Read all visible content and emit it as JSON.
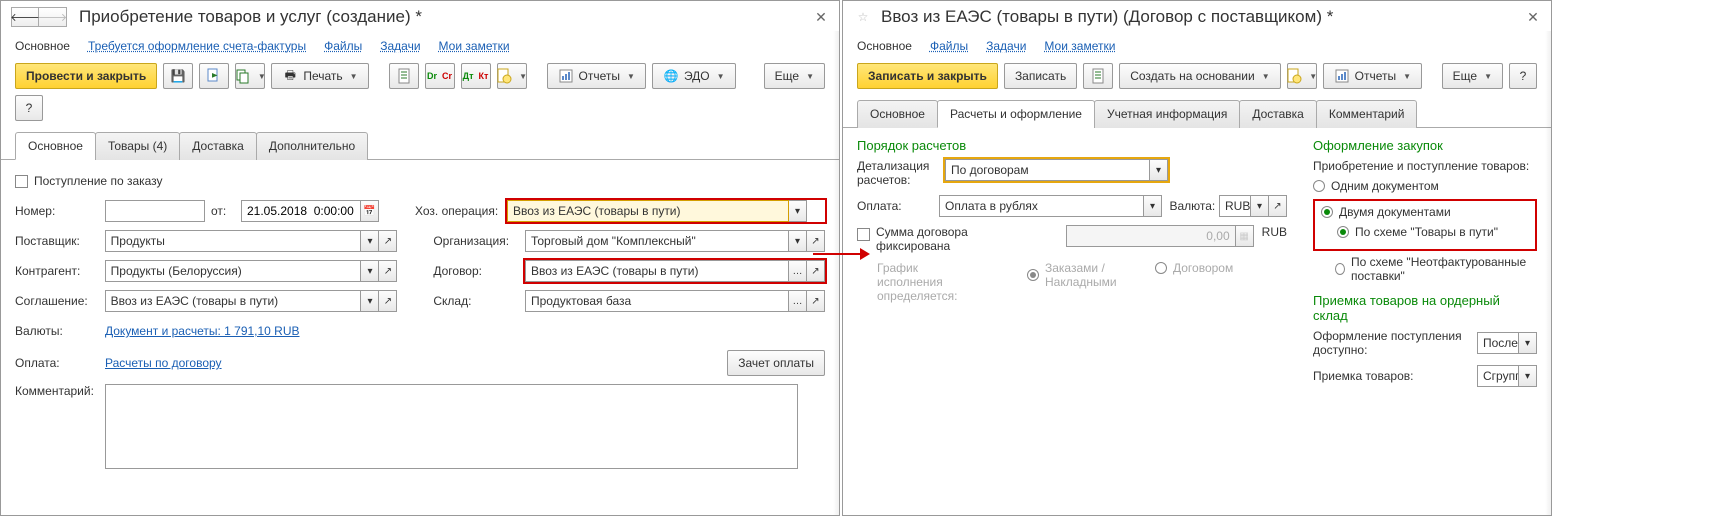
{
  "left": {
    "title": "Приобретение товаров и услуг (создание) *",
    "links": {
      "current": "Основное",
      "l1": "Требуется оформление счета-фактуры",
      "l2": "Файлы",
      "l3": "Задачи",
      "l4": "Мои заметки"
    },
    "toolbar": {
      "run_close": "Провести и закрыть",
      "print": "Печать",
      "reports": "Отчеты",
      "edo": "ЭДО",
      "more": "Еще",
      "help": "?"
    },
    "tabs": {
      "t0": "Основное",
      "t1": "Товары (4)",
      "t2": "Доставка",
      "t3": "Дополнительно"
    },
    "form": {
      "by_order": "Поступление по заказу",
      "number_lbl": "Номер:",
      "ot": "от:",
      "date": "21.05.2018  0:00:00",
      "supplier_lbl": "Поставщик:",
      "supplier": "Продукты",
      "counterparty_lbl": "Контрагент:",
      "counterparty": "Продукты (Белоруссия)",
      "agreement_lbl": "Соглашение:",
      "agreement": "Ввоз из ЕАЭС (товары в пути)",
      "op_lbl": "Хоз. операция:",
      "op": "Ввоз из ЕАЭС (товары в пути)",
      "org_lbl": "Организация:",
      "org": "Торговый дом \"Комплексный\"",
      "contract_lbl": "Договор:",
      "contract": "Ввоз из ЕАЭС (товары в пути)",
      "warehouse_lbl": "Склад:",
      "warehouse": "Продуктовая база",
      "currency_lbl": "Валюты:",
      "currency_link": "Документ и расчеты: 1 791,10 RUB",
      "payment_lbl": "Оплата:",
      "payment_link": "Расчеты по договору",
      "offset": "Зачет оплаты",
      "comment_lbl": "Комментарий:"
    }
  },
  "right": {
    "title": "Ввоз из ЕАЭС (товары в пути) (Договор с поставщиком) *",
    "links": {
      "current": "Основное",
      "l2": "Файлы",
      "l3": "Задачи",
      "l4": "Мои заметки"
    },
    "toolbar": {
      "save_close": "Записать и закрыть",
      "save": "Записать",
      "create_based": "Создать на основании",
      "reports": "Отчеты",
      "more": "Еще",
      "help": "?"
    },
    "tabs": {
      "t0": "Основное",
      "t1": "Расчеты и оформление",
      "t2": "Учетная информация",
      "t3": "Доставка",
      "t4": "Комментарий"
    },
    "form": {
      "calc_order": "Порядок расчетов",
      "detail_lbl": "Детализация расчетов:",
      "detail": "По договорам",
      "pay_lbl": "Оплата:",
      "pay": "Оплата в рублях",
      "curr_lbl": "Валюта:",
      "curr": "RUB",
      "sum_fixed": "Сумма договора фиксирована",
      "sum_val": "0,00",
      "sum_curr": "RUB",
      "schedule_lbl": "График исполнения определяется:",
      "schedule_opt1": "Заказами / Накладными",
      "schedule_opt2": "Договором",
      "purchase_title": "Оформление закупок",
      "purchase_sub": "Приобретение и поступление товаров:",
      "r1": "Одним документом",
      "r2": "Двумя документами",
      "r2a": "По схеме \"Товары в пути\"",
      "r2b": "По схеме \"Неотфактурованные поставки\"",
      "receipt_title": "Приемка товаров на ордерный склад",
      "receipt_sub": "Оформление поступления доступно:",
      "receipt_val": "После",
      "receipt2_lbl": "Приемка товаров:",
      "receipt2_val": "Сгрупп"
    }
  }
}
